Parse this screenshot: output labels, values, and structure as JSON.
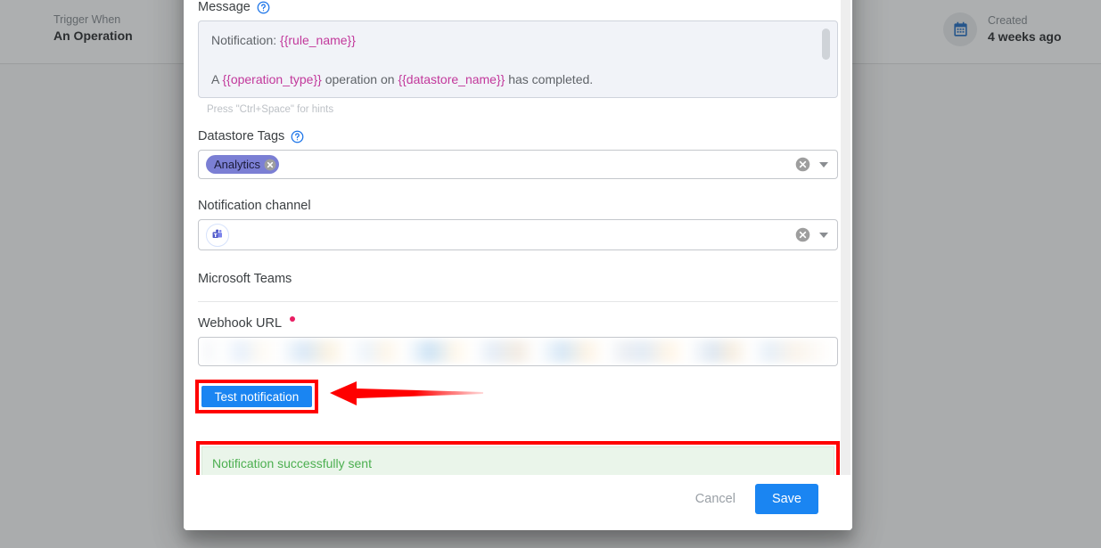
{
  "background": {
    "trigger": {
      "label": "Trigger When",
      "value": "An Operation"
    },
    "created": {
      "label": "Created",
      "value": "4 weeks ago",
      "icon": "calendar-icon"
    }
  },
  "modal": {
    "message": {
      "label": "Message",
      "help_icon": "help-circle-icon",
      "line1_prefix": "Notification: ",
      "line1_var": "{{rule_name}}",
      "line2_prefix": "A ",
      "line2_var1": "{{operation_type}}",
      "line2_mid": " operation on ",
      "line2_var2": "{{datastore_name}}",
      "line2_suffix": " has completed.",
      "hint": "Press \"Ctrl+Space\" for hints"
    },
    "datastore_tags": {
      "label": "Datastore Tags",
      "help_icon": "help-circle-icon",
      "chips": [
        {
          "label": "Analytics",
          "remove_icon": "chip-remove-icon"
        }
      ],
      "clear_icon": "clear-circle-icon",
      "caret_icon": "chevron-down-icon"
    },
    "notification_channel": {
      "label": "Notification channel",
      "selected_icon": "microsoft-teams-icon",
      "clear_icon": "clear-circle-icon",
      "caret_icon": "chevron-down-icon"
    },
    "channel_section": {
      "title": "Microsoft Teams"
    },
    "webhook": {
      "label": "Webhook URL",
      "required": true,
      "value": "",
      "placeholder": ""
    },
    "test_button": {
      "label": "Test notification"
    },
    "success_alert": {
      "text": "Notification successfully sent"
    },
    "footer": {
      "cancel_label": "Cancel",
      "save_label": "Save"
    }
  },
  "colors": {
    "primary_blue": "#1a85f2",
    "annotation_red": "#ff0000",
    "success_green": "#4caf50",
    "success_bg": "#eaf5ea",
    "chip_purple": "#7b7fd4",
    "template_var": "#c2389b",
    "required_dot": "#e91e63"
  }
}
